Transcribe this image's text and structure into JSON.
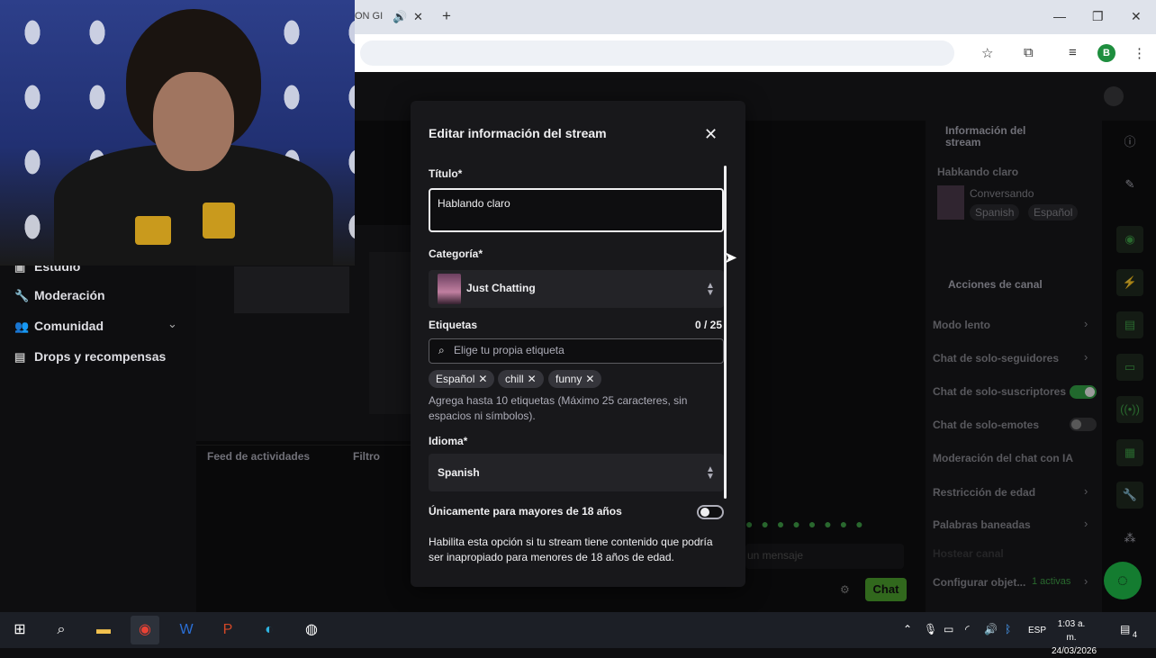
{
  "browser": {
    "tab_title": "ON GI",
    "profile_initial": "B"
  },
  "sidebar": {
    "items": [
      {
        "label": "Estudio",
        "icon": "studio-icon"
      },
      {
        "label": "Moderación",
        "icon": "wrench-icon"
      },
      {
        "label": "Comunidad",
        "icon": "people-icon"
      },
      {
        "label": "Drops y recompensas",
        "icon": "gift-icon"
      }
    ]
  },
  "feed": {
    "title": "Feed de actividades",
    "filter_label": "Filtro"
  },
  "chat": {
    "input_placeholder": "un mensaje",
    "send_label": "Chat"
  },
  "stream_info": {
    "title": "Información del stream",
    "stream_name": "Habkando claro",
    "category": "Conversando",
    "tags": [
      "Spanish",
      "Español"
    ]
  },
  "channel_actions": {
    "title": "Acciones de canal",
    "rows": [
      {
        "label": "Modo lento",
        "control": "chevron"
      },
      {
        "label": "Chat de solo-seguidores",
        "control": "chevron"
      },
      {
        "label": "Chat de solo-suscriptores",
        "control": "toggle-on"
      },
      {
        "label": "Chat de solo-emotes",
        "control": "toggle-off"
      },
      {
        "label": "Moderación del chat con IA",
        "control": "link"
      },
      {
        "label": "Restricción de edad",
        "control": "chevron"
      },
      {
        "label": "Palabras baneadas",
        "control": "chevron"
      },
      {
        "label": "Hostear canal",
        "control": "none"
      },
      {
        "label": "Configurar objet...",
        "control": "chevron"
      }
    ],
    "goal_count": "1 activas"
  },
  "modal": {
    "title": "Editar información del stream",
    "title_label": "Título*",
    "title_value": "Hablando claro",
    "category_label": "Categoría*",
    "category_value": "Just Chatting",
    "tags_label": "Etiquetas",
    "tags_counter": "0 / 25",
    "tags_placeholder": "Elige tu propia etiqueta",
    "tags": [
      "Español",
      "chill",
      "funny"
    ],
    "tags_help": "Agrega hasta 10 etiquetas (Máximo 25 caracteres, sin espacios ni símbolos).",
    "language_label": "Idioma*",
    "language_value": "Spanish",
    "mature_label": "Únicamente para mayores de 18 años",
    "mature_enabled": false,
    "mature_help": "Habilita esta opción si tu stream tiene contenido que podría ser inapropiado para menores de 18 años de edad."
  },
  "taskbar": {
    "language": "ESP",
    "time": "1:03 a. m.",
    "date": "24/03/2026",
    "notification_count": "4"
  },
  "colors": {
    "accent_green": "#34a046",
    "background": "#0e0e10",
    "modal_bg": "#18181b"
  }
}
